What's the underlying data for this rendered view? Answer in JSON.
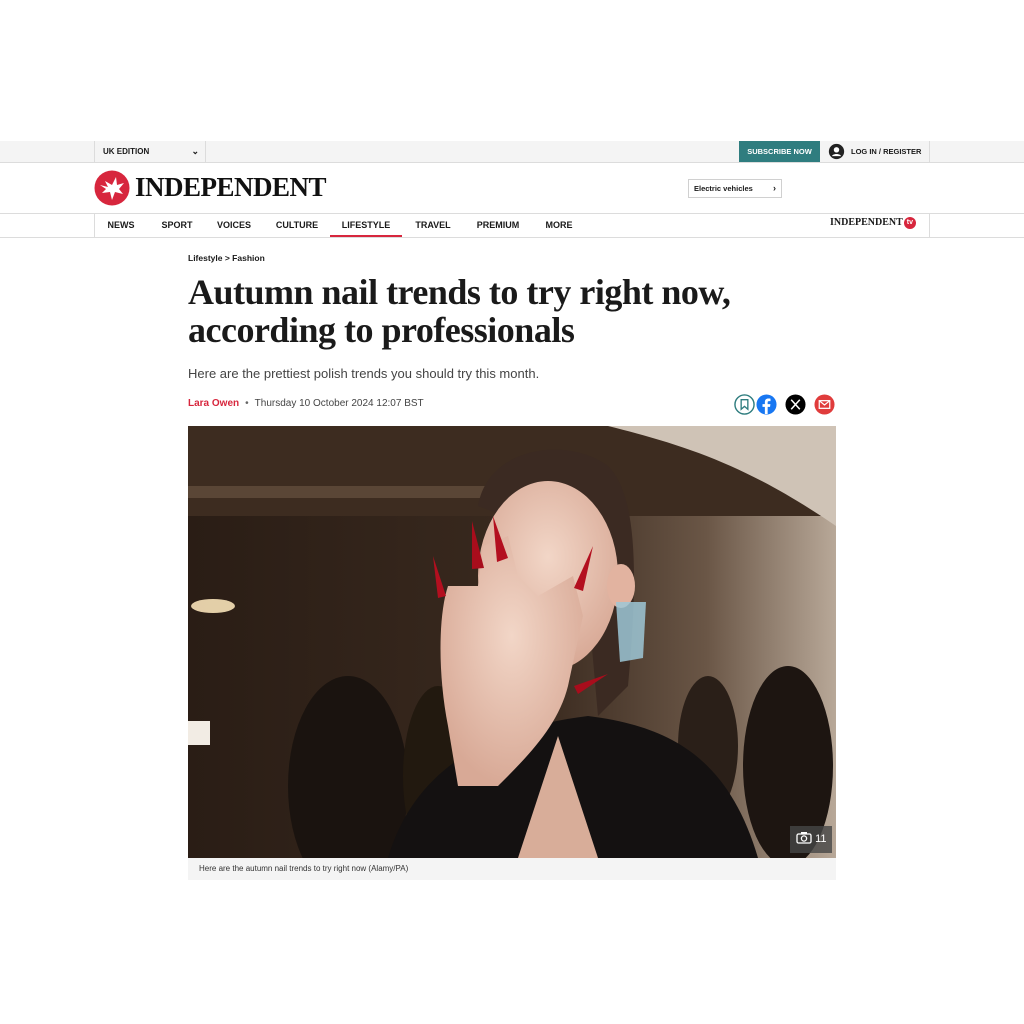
{
  "topbar": {
    "edition": "UK EDITION",
    "subscribe": "SUBSCRIBE NOW",
    "login": "LOG IN / REGISTER"
  },
  "masthead": {
    "brand": "INDEPENDENT",
    "trending_link": "Electric vehicles"
  },
  "nav": {
    "items": [
      "NEWS",
      "SPORT",
      "VOICES",
      "CULTURE",
      "LIFESTYLE",
      "TRAVEL",
      "PREMIUM",
      "MORE"
    ],
    "active": "LIFESTYLE",
    "tv_brand": "INDEPENDENT",
    "tv_badge": "tv"
  },
  "article": {
    "breadcrumb": "Lifestyle > Fashion",
    "headline": "Autumn nail trends to try right now, according to professionals",
    "standfirst": "Here are the prettiest polish trends you should try this month.",
    "author": "Lara Owen",
    "date": "Thursday 10 October 2024 12:07 BST",
    "share_icons": [
      "bookmark-icon",
      "facebook-icon",
      "x-icon",
      "email-icon"
    ],
    "gallery_count": "11",
    "caption": "Here are the autumn nail trends to try right now (Alamy/PA)"
  },
  "colors": {
    "accent_red": "#d7263d",
    "subscribe_teal": "#2f7d7f"
  }
}
